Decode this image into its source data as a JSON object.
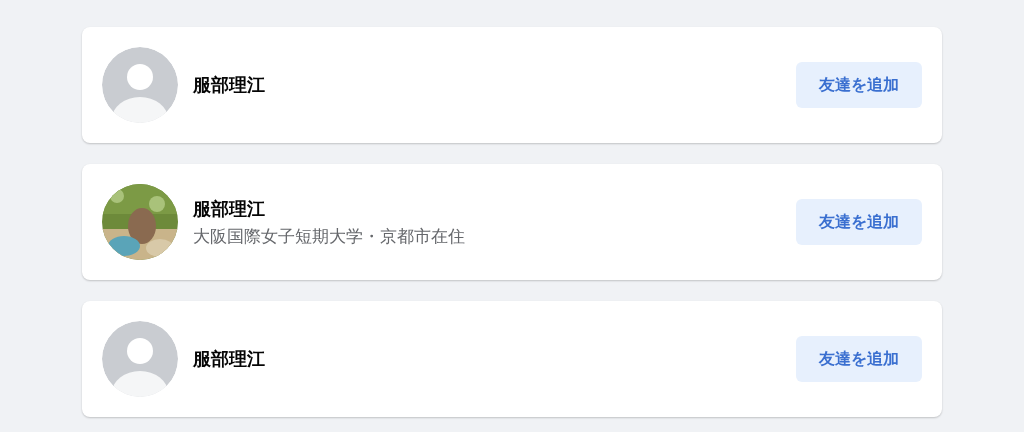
{
  "people": [
    {
      "name": "服部理江",
      "avatar": {
        "kind": "default"
      },
      "button": "友達を追加"
    },
    {
      "name": "服部理江",
      "subtitle": "大阪国際女子短期大学・京都市在住",
      "button": "友達を追加"
    },
    {
      "name": "服部理江",
      "avatar": {
        "kind": "default"
      },
      "button": "友達を追加"
    }
  ]
}
